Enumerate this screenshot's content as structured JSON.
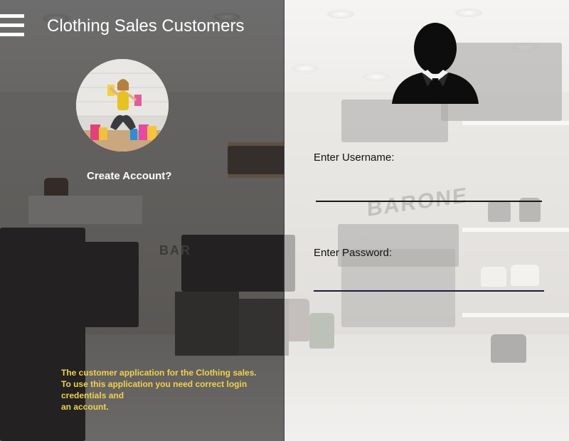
{
  "app": {
    "title": "Clothing Sales Customers"
  },
  "menu": {
    "icon": "hamburger-menu-icon"
  },
  "left_panel": {
    "avatar_image": "shopping-woman-with-bags",
    "create_account_label": "Create Account?",
    "description_lines": [
      "The customer application for the Clothing sales.",
      "To use this application you need correct login",
      "credentials and",
      "an account."
    ],
    "description_color": "#f2d248"
  },
  "login": {
    "user_icon": "user-silhouette-icon",
    "username_label": "Enter Username:",
    "username_value": "",
    "password_label": "Enter Password:",
    "password_value": ""
  },
  "background": {
    "store_sign": "BARONE"
  }
}
